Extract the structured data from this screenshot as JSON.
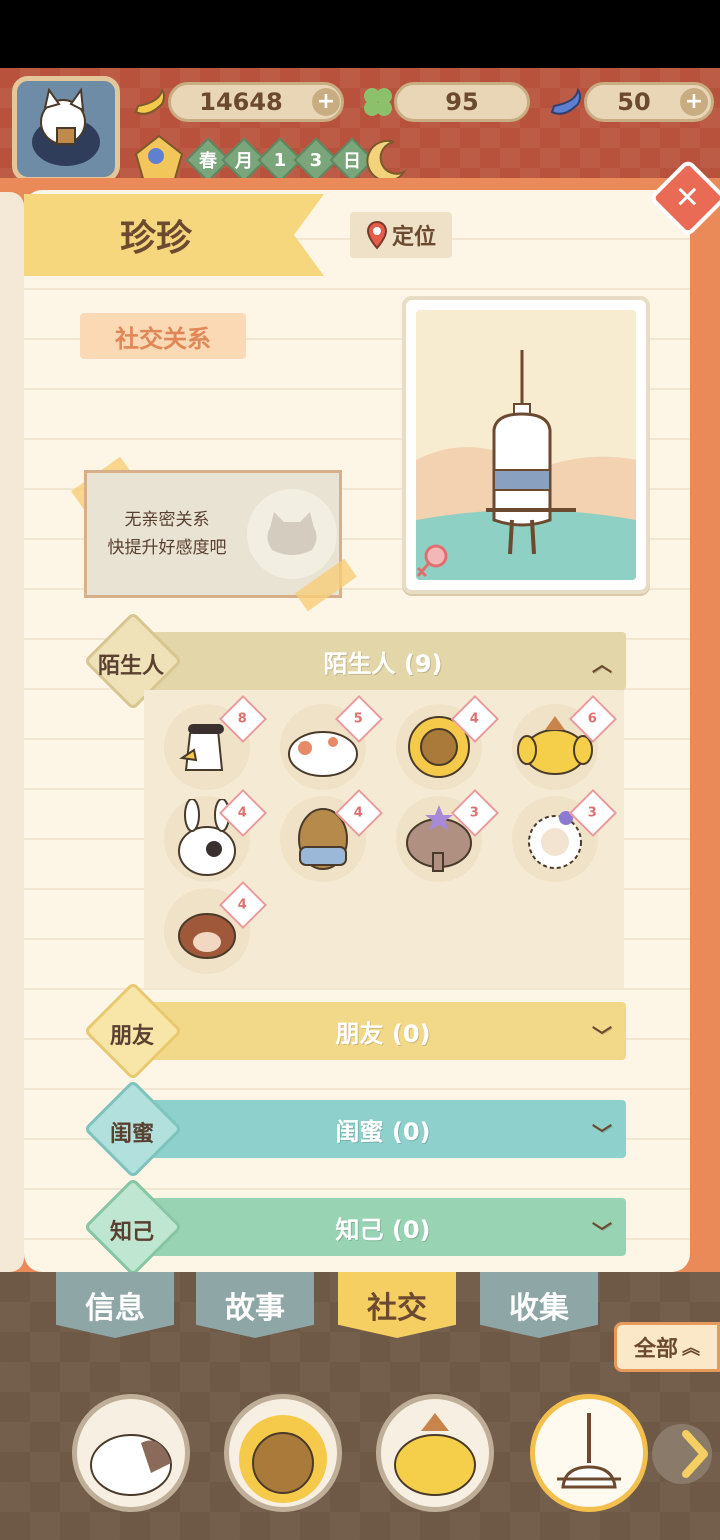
{
  "hud": {
    "bananas": "14648",
    "clovers": "95",
    "blue_bananas": "50",
    "date": [
      "春",
      "月",
      "1",
      "3",
      "日"
    ]
  },
  "character": {
    "name": "珍珍",
    "locate_label": "定位"
  },
  "social": {
    "section_label": "社交关系",
    "no_relation_line1": "无亲密关系",
    "no_relation_line2": "快提升好感度吧"
  },
  "categories": {
    "stranger": {
      "tag": "陌生人",
      "title": "陌生人 (9)"
    },
    "friend": {
      "tag": "朋友",
      "title": "朋友 (0)"
    },
    "bestie": {
      "tag": "闺蜜",
      "title": "闺蜜 (0)"
    },
    "soulmate": {
      "tag": "知己",
      "title": "知己 (0)"
    }
  },
  "strangers": [
    {
      "icon": "bird-npc-icon",
      "hearts": "8"
    },
    {
      "icon": "cat-npc-icon",
      "hearts": "5"
    },
    {
      "icon": "sunflower-npc-icon",
      "hearts": "4"
    },
    {
      "icon": "dog-npc-icon",
      "hearts": "6"
    },
    {
      "icon": "rabbit-npc-icon",
      "hearts": "4"
    },
    {
      "icon": "potato-npc-icon",
      "hearts": "4"
    },
    {
      "icon": "elephant-npc-icon",
      "hearts": "3"
    },
    {
      "icon": "sheep-npc-icon",
      "hearts": "3"
    },
    {
      "icon": "beaver-npc-icon",
      "hearts": "4"
    }
  ],
  "tabs": {
    "info": "信息",
    "story": "故事",
    "social": "社交",
    "collect": "收集"
  },
  "all_button": "全部",
  "colors": {
    "accent": "#e98a58",
    "stranger_bar": "#e3d6a8",
    "friend_bar": "#f2d98a",
    "bestie_bar": "#8ed0cc",
    "soulmate_bar": "#98d4b4"
  }
}
